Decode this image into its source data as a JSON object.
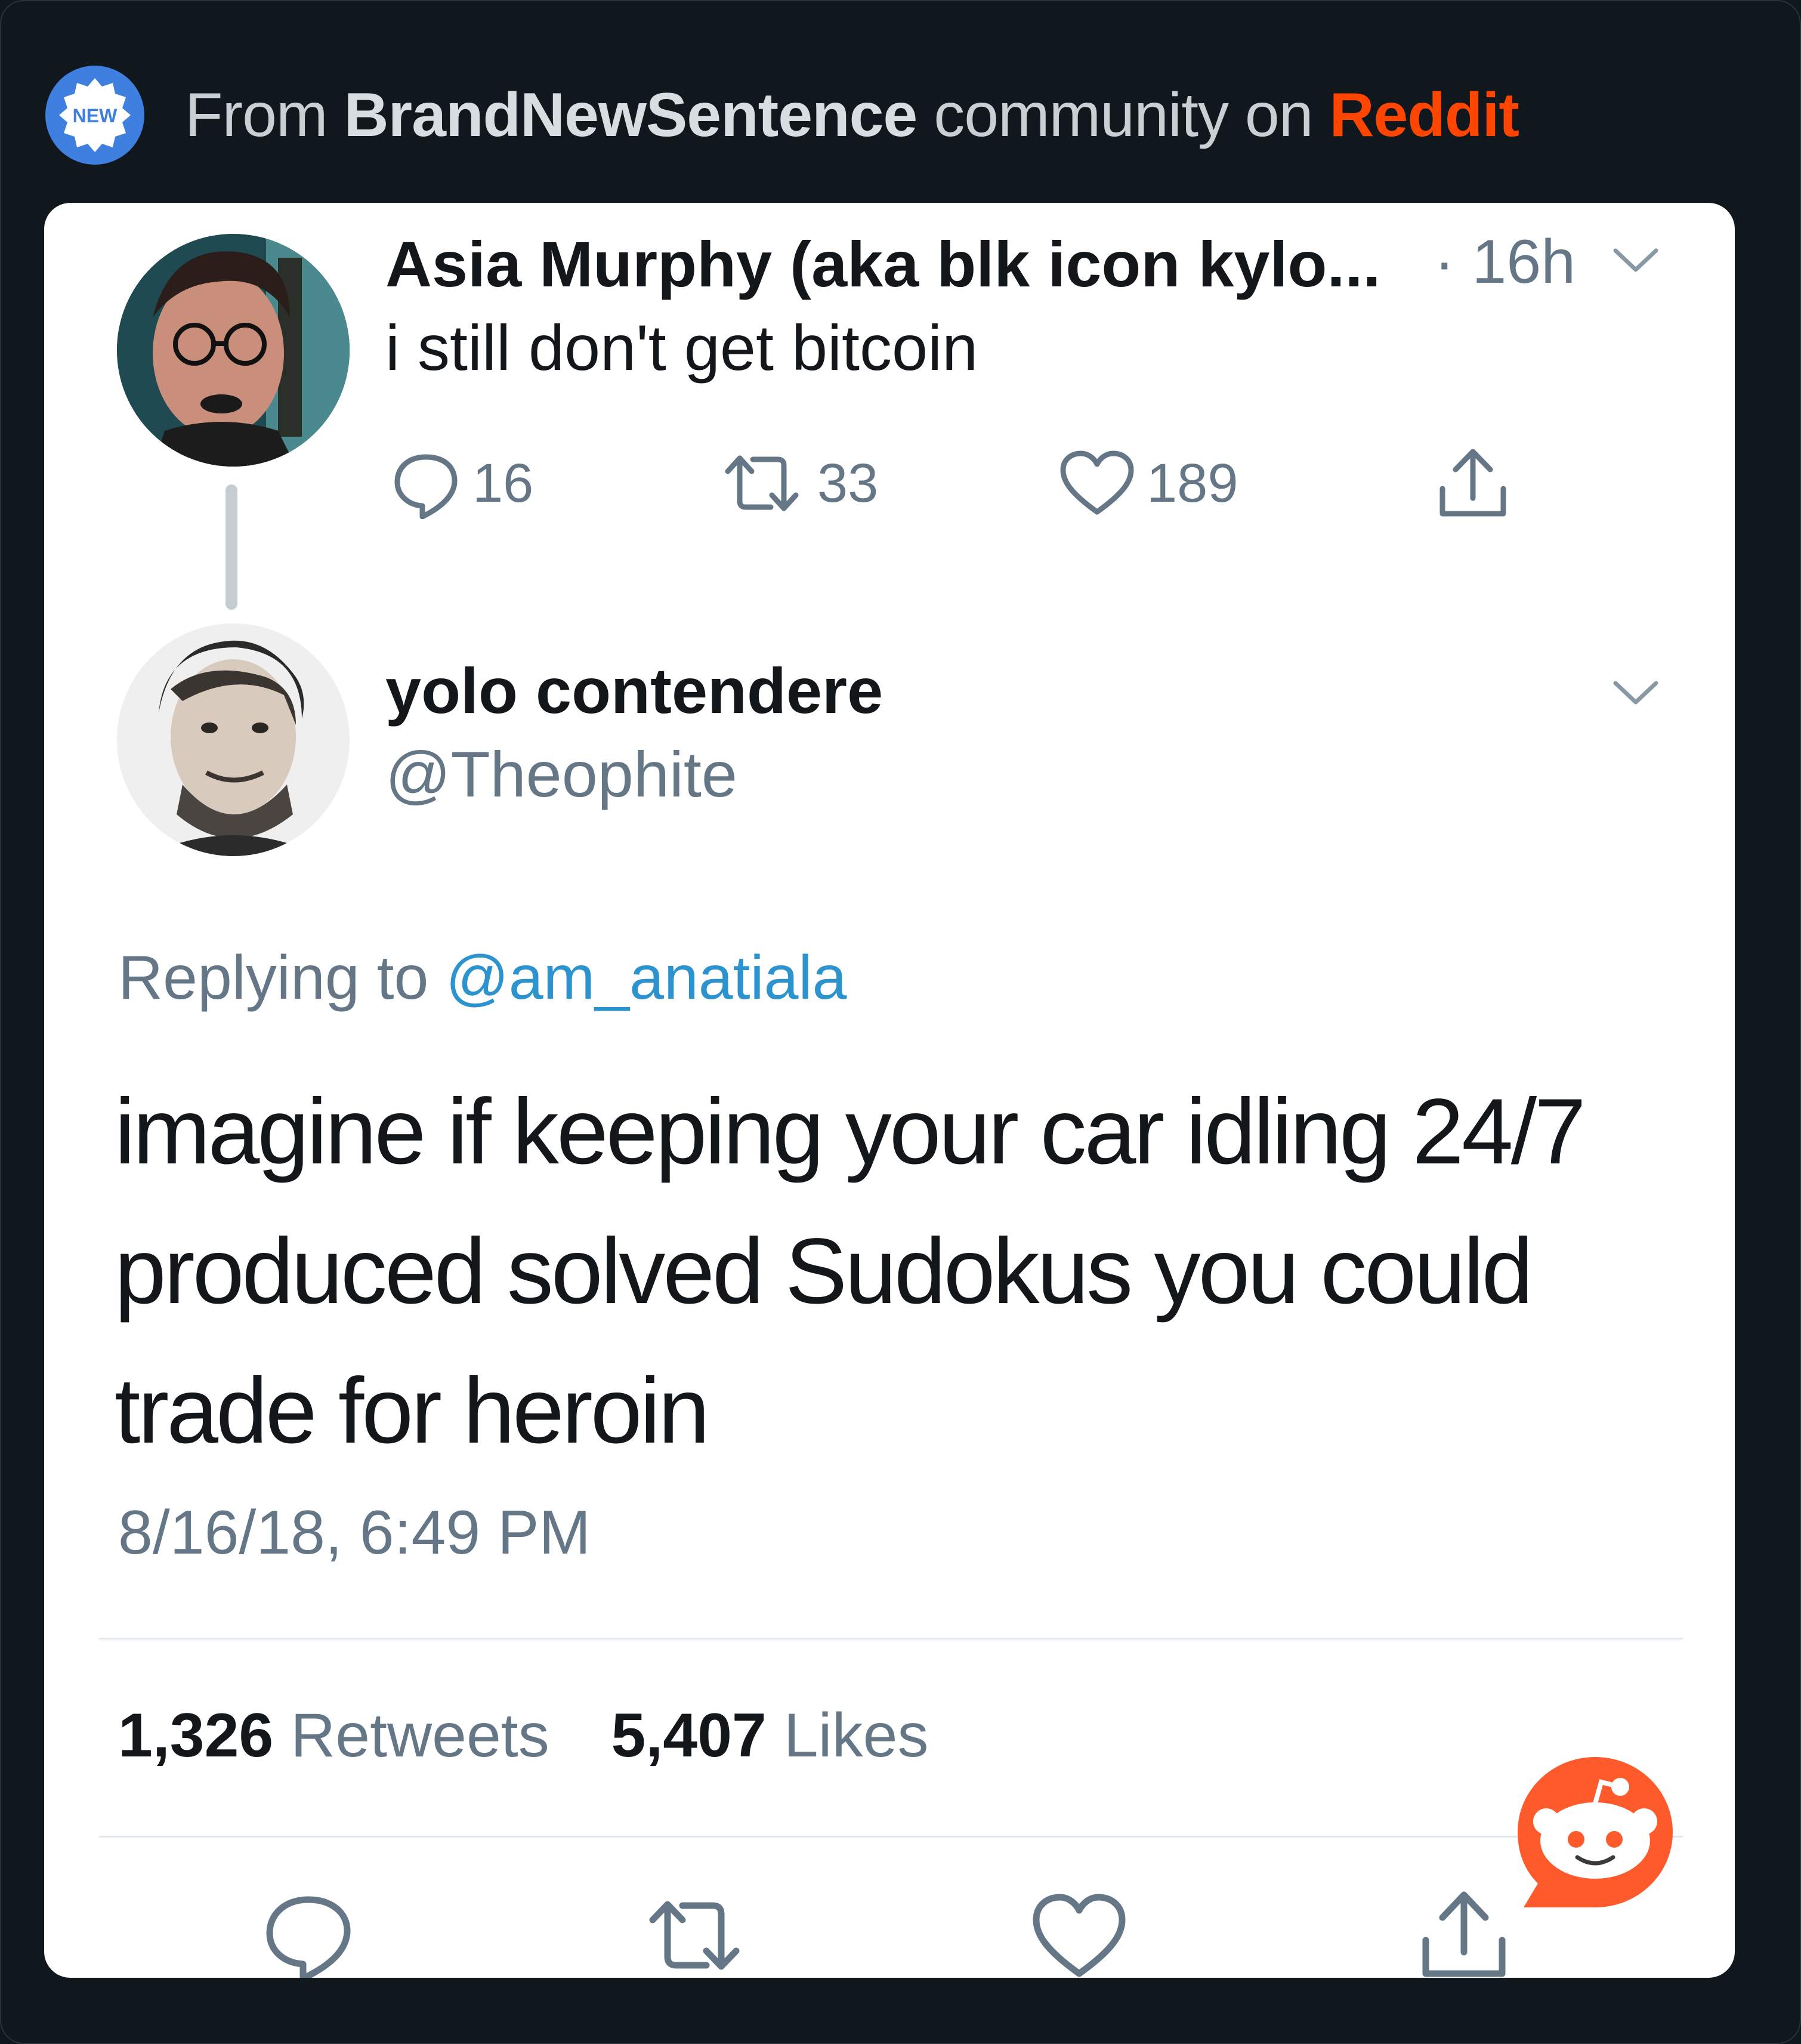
{
  "header": {
    "badge_text": "NEW",
    "prefix": "From",
    "community": "BrandNewSentence",
    "middle": "community on",
    "site": "Reddit"
  },
  "parent_tweet": {
    "name": "Asia Murphy (aka blk icon kylo...",
    "time": "· 16h",
    "text": "i still don't get bitcoin",
    "replies": "16",
    "retweets": "33",
    "likes": "189"
  },
  "main_tweet": {
    "name": "yolo contendere",
    "handle": "@Theophite",
    "replying_prefix": "Replying to",
    "replying_to": "@am_anatiala",
    "text_lines": [
      "imagine if keeping your car idling 24/7",
      "produced solved Sudokus you could",
      "trade for heroin"
    ],
    "timestamp": "8/16/18, 6:49 PM",
    "retweet_count": "1,326",
    "retweet_label": "Retweets",
    "like_count": "5,407",
    "like_label": "Likes"
  },
  "colors": {
    "background": "#11181d",
    "card": "#ffffff",
    "reddit_orange": "#ff4500",
    "mention_blue": "#2c93cf",
    "muted": "#657786",
    "badge_blue": "#3f7fe0"
  },
  "icons": [
    "new-badge-icon",
    "reply-icon",
    "retweet-icon",
    "like-icon",
    "share-icon",
    "chevron-down-icon",
    "reddit-snoo-icon"
  ]
}
